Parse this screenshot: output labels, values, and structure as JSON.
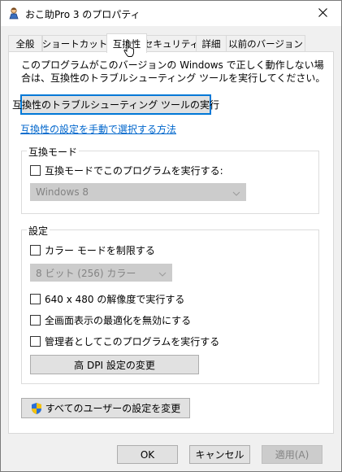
{
  "window": {
    "title": "おこ助Pro 3 のプロパティ",
    "app_icon": "app-icon",
    "close_glyph": "✕"
  },
  "tabs": [
    {
      "label": "全般"
    },
    {
      "label": "ショートカット"
    },
    {
      "label": "互換性",
      "active": true
    },
    {
      "label": "セキュリティ"
    },
    {
      "label": "詳細"
    },
    {
      "label": "以前のバージョン"
    }
  ],
  "compat": {
    "description": "このプログラムがこのバージョンの Windows で正しく動作しない場合は、互換性のトラブルシューティング ツールを実行してください。",
    "troubleshooter_button": "互換性のトラブルシューティング ツールの実行",
    "manual_link": "互換性の設定を手動で選択する方法"
  },
  "compat_mode": {
    "group_label": "互換モード",
    "checkbox_label": "互換モードでこのプログラムを実行する:",
    "checked": false,
    "select_value": "Windows 8"
  },
  "settings": {
    "group_label": "設定",
    "reduced_color_label": "カラー モードを制限する",
    "color_select_value": "8 ビット (256) カラー",
    "res_640_label": "640 x 480 の解像度で実行する",
    "disable_fullscreen_label": "全画面表示の最適化を無効にする",
    "run_as_admin_label": "管理者としてこのプログラムを実行する",
    "high_dpi_button": "高 DPI 設定の変更"
  },
  "all_users_button": "すべてのユーザーの設定を変更",
  "footer": {
    "ok": "OK",
    "cancel": "キャンセル",
    "apply": "適用(A)"
  },
  "colors": {
    "accent": "#0078d7",
    "link": "#0066cc",
    "shield_blue": "#2a6fd6",
    "shield_yellow": "#f4c20d"
  }
}
